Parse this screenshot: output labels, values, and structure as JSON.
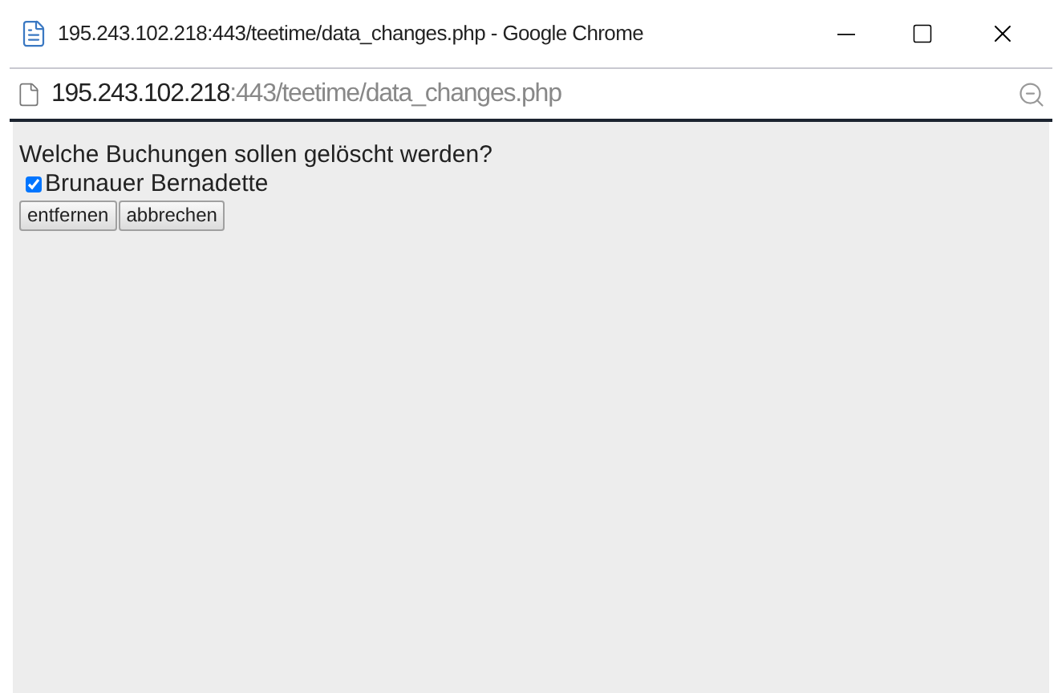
{
  "window": {
    "title": "195.243.102.218:443/teetime/data_changes.php - Google Chrome"
  },
  "address_bar": {
    "host": "195.243.102.218",
    "path": ":443/teetime/data_changes.php"
  },
  "page": {
    "question": "Welche Buchungen sollen gelöscht werden?",
    "bookings": [
      {
        "label": "Brunauer Bernadette",
        "checked": true
      }
    ],
    "buttons": [
      "entfernen",
      "abbrechen"
    ]
  }
}
